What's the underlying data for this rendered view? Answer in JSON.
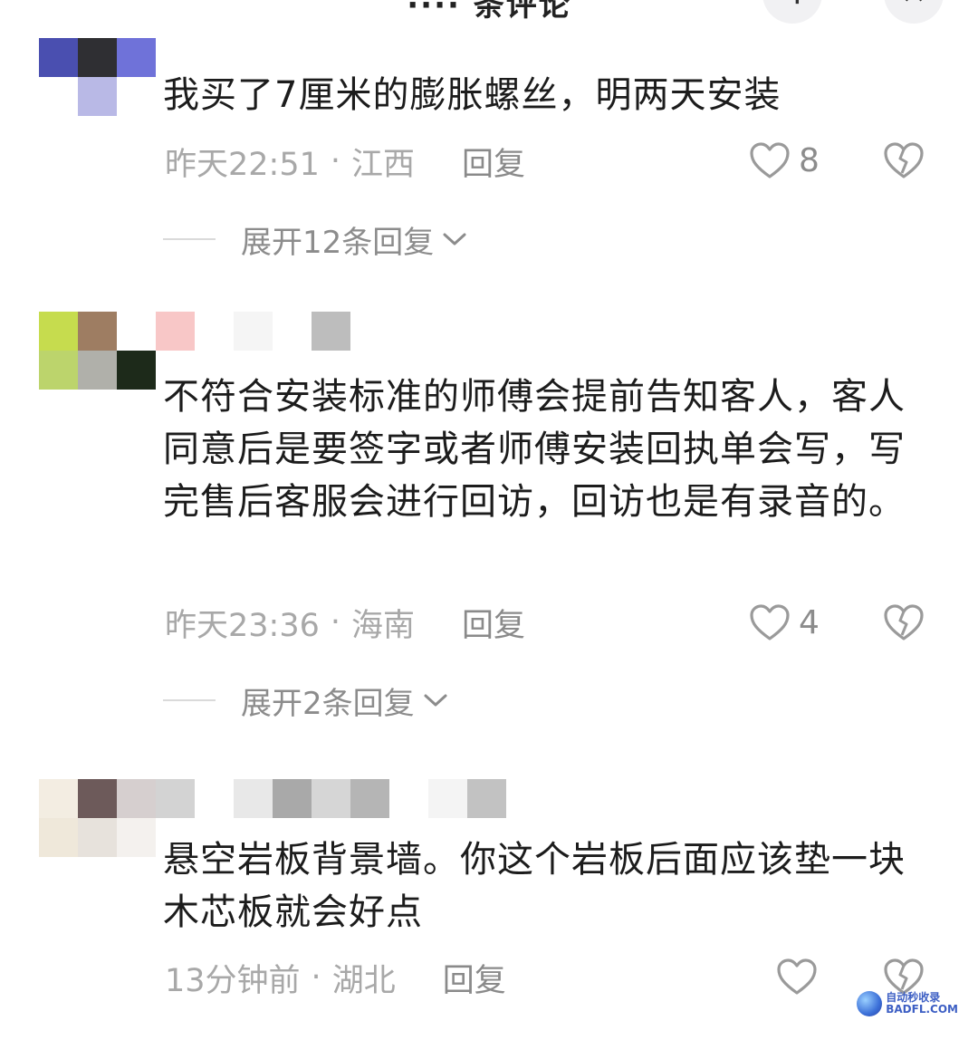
{
  "header": {
    "title": "···· 条评论",
    "left_icon": "back-icon",
    "right_icon": "close-icon"
  },
  "comments": [
    {
      "text": "我买了7厘米的膨胀螺丝，明两天安装",
      "time": "昨天22:51",
      "location": "江西",
      "reply_label": "回复",
      "likes": "8",
      "expand": "展开12条回复"
    },
    {
      "text": "不符合安装标准的师傅会提前告知客人，客人同意后是要签字或者师傅安装回执单会写，写完售后客服会进行回访，回访也是有录音的。",
      "time": "昨天23:36",
      "location": "海南",
      "reply_label": "回复",
      "likes": "4",
      "expand": "展开2条回复"
    },
    {
      "text": "悬空岩板背景墙。你这个岩板后面应该垫一块木芯板就会好点",
      "time": "13分钟前",
      "location": "湖北",
      "reply_label": "回复",
      "likes": ""
    }
  ],
  "watermark": {
    "line1": "自动秒收录",
    "line2": "BADFL.COM"
  },
  "colors": {
    "text": "#1c1c1c",
    "meta": "#a8a8a8",
    "icon": "#9a9a9a"
  }
}
